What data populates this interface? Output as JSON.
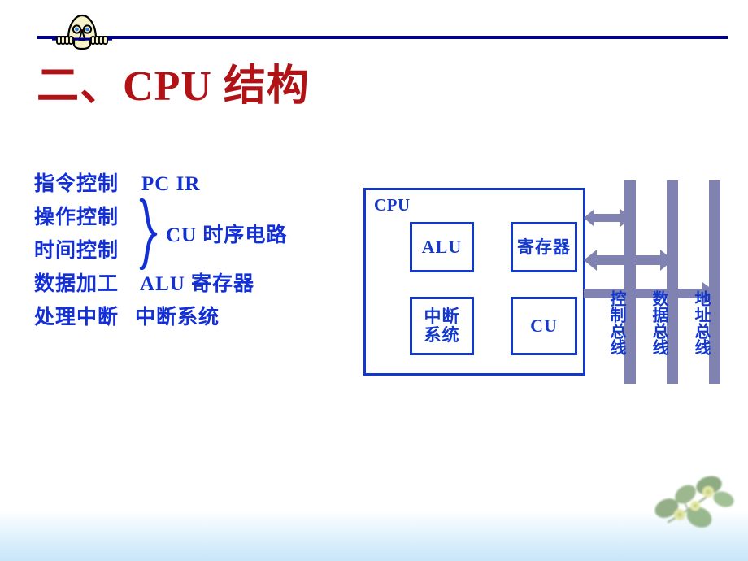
{
  "slide": {
    "title_cjk_prefix": "二、",
    "title_latin": "CPU",
    "title_cjk_suffix": "结构",
    "title_color": "#b01216",
    "rule_color": "#00008c",
    "accent_blue": "#1338cd",
    "bus_color": "#8082b2"
  },
  "outline": {
    "rows": [
      {
        "label": "指令控制",
        "value": "PC  IR"
      },
      {
        "label": "操作控制",
        "value": ""
      },
      {
        "label": "时间控制",
        "value": ""
      },
      {
        "label": "数据加工",
        "value": "ALU  寄存器"
      },
      {
        "label": "处理中断",
        "value": "中断系统"
      }
    ],
    "brace_text": "CU  时序电路"
  },
  "diagram": {
    "cpu_label": "CPU",
    "units": [
      {
        "id": "alu",
        "label": "ALU"
      },
      {
        "id": "reg",
        "label": "寄存器"
      },
      {
        "id": "interrupt",
        "label": "中断\n系统"
      },
      {
        "id": "cu",
        "label": "CU"
      }
    ],
    "buses": [
      {
        "id": "control",
        "label": "控制总线",
        "arrow": "bidirectional"
      },
      {
        "id": "data",
        "label": "数据总线",
        "arrow": "bidirectional"
      },
      {
        "id": "address",
        "label": "地址总线",
        "arrow": "right"
      }
    ]
  },
  "decor": {
    "kilroy_icon": "kilroy-peeking-face-icon",
    "leaf_icon": "leaf-sprig-icon"
  }
}
